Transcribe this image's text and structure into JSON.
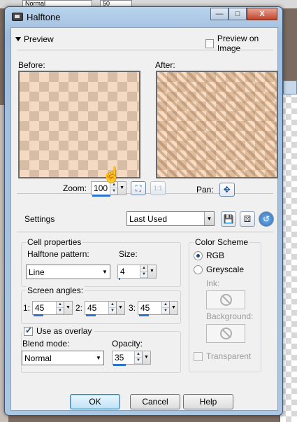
{
  "background": {
    "blend_combo_value": "Normal",
    "opacity_value": "50"
  },
  "window": {
    "title": "Halftone",
    "minimize": "—",
    "maximize": "□",
    "close": "X"
  },
  "preview": {
    "toggle_label": "Preview",
    "preview_on_image_label": "Preview on Image",
    "preview_on_image_checked": false,
    "before_label": "Before:",
    "after_label": "After:",
    "zoom_label": "Zoom:",
    "zoom_value": "100",
    "fit_label": "1:1",
    "pan_label": "Pan:"
  },
  "settings": {
    "label": "Settings",
    "preset_value": "Last Used"
  },
  "cell_properties": {
    "group_label": "Cell properties",
    "pattern_label": "Halftone pattern:",
    "pattern_value": "Line",
    "size_label": "Size:",
    "size_value": "4"
  },
  "screen_angles": {
    "group_label": "Screen angles:",
    "items": [
      {
        "label": "1:",
        "value": "45"
      },
      {
        "label": "2:",
        "value": "45"
      },
      {
        "label": "3:",
        "value": "45"
      }
    ]
  },
  "overlay": {
    "checkbox_label": "Use as overlay",
    "checked": true,
    "blend_label": "Blend mode:",
    "blend_value": "Normal",
    "opacity_label": "Opacity:",
    "opacity_value": "35"
  },
  "color_scheme": {
    "group_label": "Color Scheme",
    "rgb_label": "RGB",
    "greyscale_label": "Greyscale",
    "selected": "RGB",
    "ink_label": "Ink:",
    "background_label": "Background:",
    "transparent_label": "Transparent"
  },
  "buttons": {
    "ok": "OK",
    "cancel": "Cancel",
    "help": "Help"
  },
  "colors": {
    "title_gradient": "#b9d3ec",
    "accent": "#2c73d2",
    "close": "#c1432c"
  }
}
